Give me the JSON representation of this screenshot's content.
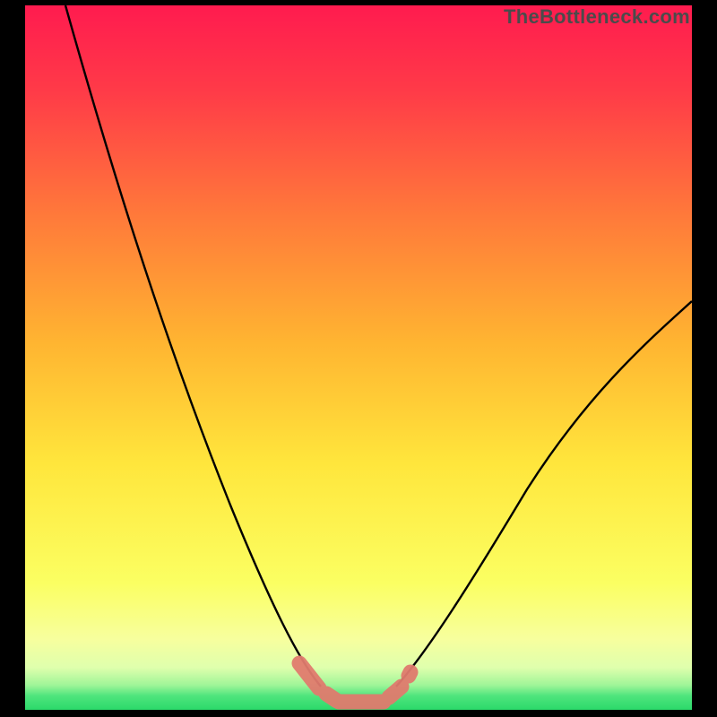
{
  "watermark": "TheBottleneck.com",
  "colors": {
    "black": "#000000",
    "curve": "#000000",
    "salmon": "#e07b6e",
    "green": "#2bd96a"
  },
  "chart_data": {
    "type": "line",
    "title": "",
    "xlabel": "",
    "ylabel": "",
    "xlim": [
      0,
      100
    ],
    "ylim": [
      0,
      100
    ],
    "grid": false,
    "legend": false,
    "background_gradient": [
      "#ff1b4f",
      "#ffe63c",
      "#f7ff9e",
      "#2bd96a"
    ],
    "series": [
      {
        "name": "left-curve",
        "x": [
          6,
          12,
          18,
          24,
          30,
          36,
          40,
          43,
          45
        ],
        "y": [
          100,
          86,
          70,
          53,
          35,
          18,
          8,
          3,
          1
        ]
      },
      {
        "name": "right-curve",
        "x": [
          56,
          60,
          66,
          74,
          82,
          90,
          98,
          100
        ],
        "y": [
          1,
          4,
          10,
          20,
          32,
          44,
          55,
          58
        ]
      },
      {
        "name": "valley-salmon-segments",
        "x": [
          42,
          45,
          47,
          54,
          56,
          58
        ],
        "y": [
          4,
          1,
          0.5,
          0.5,
          1,
          3
        ]
      }
    ],
    "annotations": []
  }
}
